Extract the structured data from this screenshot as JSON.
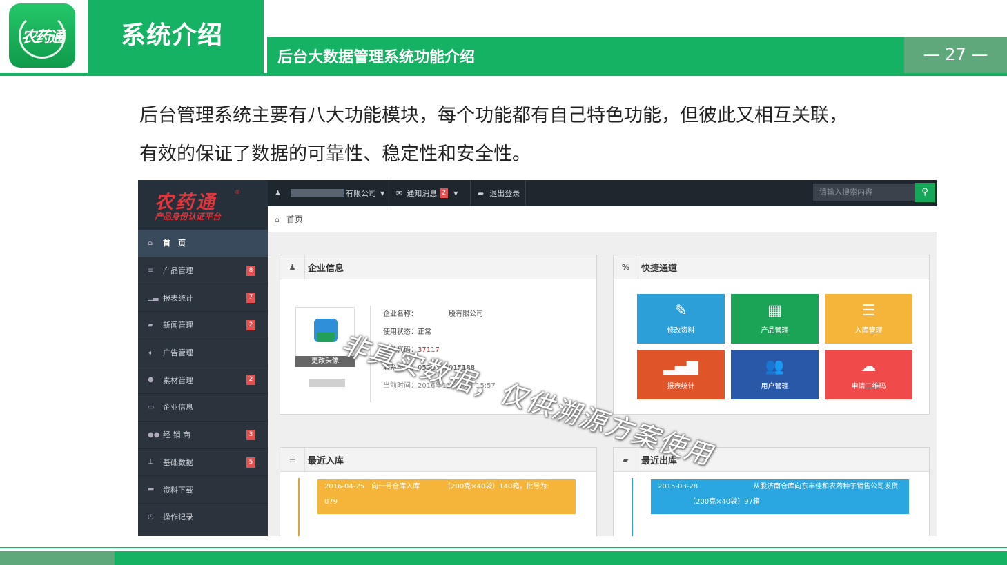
{
  "slide": {
    "logo_text": "农药通",
    "section_title": "系统介绍",
    "subtitle": "后台大数据管理系统功能介绍",
    "page_number": "— 27 —",
    "intro_line1": "后台管理系统主要有八大功能模块，每个功能都有自己特色功能，但彼此又相互关联，",
    "intro_line2": "有效的保证了数据的可靠性、稳定性和安全性。",
    "watermark": "非真实数据，仅供溯源方案使用",
    "colors": {
      "primary_green": "#14b262",
      "muted_green": "#5fa87c"
    }
  },
  "admin": {
    "brand": {
      "title": "农药通",
      "tagline": "产品身份认证平台",
      "reg_mark": "®"
    },
    "sidebar": [
      {
        "label": "首　页",
        "icon": "home-icon",
        "glyph": "⌂",
        "badge": ""
      },
      {
        "label": "产品管理",
        "icon": "list-icon",
        "glyph": "≡",
        "badge": "8"
      },
      {
        "label": "报表统计",
        "icon": "bar-chart-icon",
        "glyph": "▁▃",
        "badge": "7"
      },
      {
        "label": "新闻管理",
        "icon": "book-icon",
        "glyph": "▰",
        "badge": "2"
      },
      {
        "label": "广告管理",
        "icon": "bullhorn-icon",
        "glyph": "◂",
        "badge": ""
      },
      {
        "label": "素材管理",
        "icon": "palette-icon",
        "glyph": "●",
        "badge": "2"
      },
      {
        "label": "企业信息",
        "icon": "inbox-icon",
        "glyph": "▭",
        "badge": ""
      },
      {
        "label": "经 销 商",
        "icon": "users-icon",
        "glyph": "●●",
        "badge": "3"
      },
      {
        "label": "基础数据",
        "icon": "sitemap-icon",
        "glyph": "⊥",
        "badge": "5"
      },
      {
        "label": "资料下载",
        "icon": "folder-icon",
        "glyph": "▬",
        "badge": ""
      },
      {
        "label": "操作记录",
        "icon": "clock-icon",
        "glyph": "◷",
        "badge": ""
      }
    ],
    "topbar": {
      "company": "有限公司",
      "notifications_label": "通知消息",
      "notifications_count": "2",
      "logout_label": "退出登录",
      "search_placeholder": "请输入搜索内容",
      "search_glyph": "⚲"
    },
    "breadcrumb": "首页",
    "company_panel": {
      "title": "企业信息",
      "avatar_button": "更改头像",
      "name_line": "企业名称：　　　　　股有限公司",
      "status_line": "使用状态：正常",
      "code_label": "企业代码：",
      "code_value": "37117",
      "phone_line": "联系电话：0531- 88015188",
      "time_line": "当前时间：2016年11月16日  15:57"
    },
    "quick_panel": {
      "title": "快捷通道",
      "tiles": [
        {
          "label": "修改资料",
          "icon": "pencil-icon",
          "glyph": "✎",
          "color": "#2d9fd8"
        },
        {
          "label": "产品管理",
          "icon": "grid-icon",
          "glyph": "▦",
          "color": "#1ba356"
        },
        {
          "label": "入库管理",
          "icon": "align-left-icon",
          "glyph": "☰",
          "color": "#f5b43a"
        },
        {
          "label": "报表统计",
          "icon": "signal-icon",
          "glyph": "▂▄▆",
          "color": "#e0542a"
        },
        {
          "label": "用户管理",
          "icon": "users-icon",
          "glyph": "👥",
          "color": "#2a58a8"
        },
        {
          "label": "申请二维码",
          "icon": "cloud-upload-icon",
          "glyph": "☁",
          "color": "#f04a4a"
        }
      ]
    },
    "inbound_panel": {
      "title": "最近入库",
      "entry": {
        "line1": "2016-04-25　向一号仓库入库　　　　（200克×40袋）140箱，批号为:",
        "line2": "079"
      }
    },
    "outbound_panel": {
      "title": "最近出库",
      "entry": {
        "line1": "2015-03-28　　　　　　　　从股济南仓库向东丰佳和农药种子销售公司发货",
        "line2": "　　　　　（200克×40袋）97箱"
      }
    }
  }
}
